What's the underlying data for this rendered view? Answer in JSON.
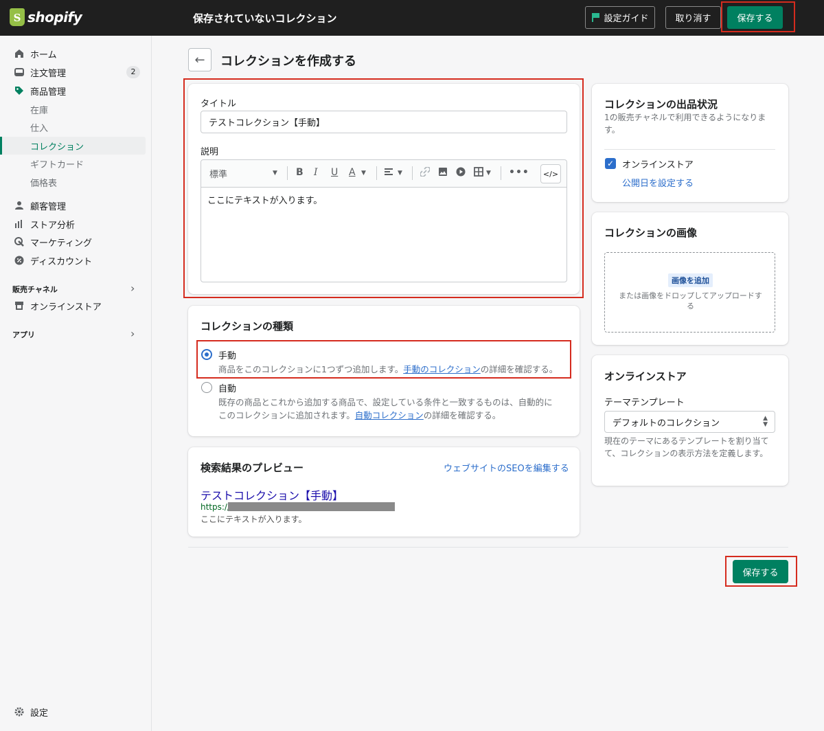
{
  "topbar": {
    "logo_text": "shopify",
    "title": "保存されていないコレクション",
    "guide_label": "設定ガイド",
    "discard_label": "取り消す",
    "save_label": "保存する"
  },
  "sidebar": {
    "items": [
      {
        "label": "ホーム",
        "icon": "home-icon"
      },
      {
        "label": "注文管理",
        "icon": "orders-icon",
        "badge": "2"
      },
      {
        "label": "商品管理",
        "icon": "tag-icon"
      },
      {
        "label": "在庫"
      },
      {
        "label": "仕入"
      },
      {
        "label": "コレクション"
      },
      {
        "label": "ギフトカード"
      },
      {
        "label": "価格表"
      },
      {
        "label": "顧客管理",
        "icon": "customer-icon"
      },
      {
        "label": "ストア分析",
        "icon": "analytics-icon"
      },
      {
        "label": "マーケティング",
        "icon": "marketing-icon"
      },
      {
        "label": "ディスカウント",
        "icon": "discount-icon"
      }
    ],
    "sales_channels_label": "販売チャネル",
    "online_store_label": "オンラインストア",
    "apps_label": "アプリ",
    "settings_label": "設定"
  },
  "page": {
    "back_icon": "arrow-left-icon",
    "title": "コレクションを作成する"
  },
  "details_card": {
    "title_label": "タイトル",
    "title_value": "テストコレクション【手動】",
    "description_label": "説明",
    "format_select": "標準",
    "description_value": "ここにテキストが入ります。"
  },
  "collection_type": {
    "title": "コレクションの種類",
    "manual_label": "手動",
    "manual_help": "商品をこのコレクションに1つずつ追加します。",
    "manual_link": "手動のコレクション",
    "manual_help_suffix": "の詳細を確認する。",
    "auto_label": "自動",
    "auto_help_1": "既存の商品とこれから追加する商品で、設定している条件と一致するものは、自動的に",
    "auto_help_2": "このコレクションに追加されます。",
    "auto_link": "自動コレクション",
    "auto_help_suffix": "の詳細を確認する。",
    "selected": "手動"
  },
  "seo_preview": {
    "title": "検索結果のプレビュー",
    "edit_link": "ウェブサイトのSEOを編集する",
    "preview_title": "テストコレクション【手動】",
    "url_prefix": "https://",
    "description": "ここにテキストが入ります。"
  },
  "availability": {
    "title": "コレクションの出品状況",
    "subtitle": "1の販売チャネルで利用できるようになります。",
    "channel": "オンラインストア",
    "schedule_link": "公開日を設定する"
  },
  "image_card": {
    "title": "コレクションの画像",
    "add_label": "画像を追加",
    "drop_hint": "または画像をドロップしてアップロードする"
  },
  "online_store_card": {
    "title": "オンラインストア",
    "template_label": "テーマテンプレート",
    "template_value": "デフォルトのコレクション",
    "help": "現在のテーマにあるテンプレートを割り当てて、コレクションの表示方法を定義します。"
  },
  "footer": {
    "save_label": "保存する"
  },
  "colors": {
    "primary": "#008060",
    "topbar": "#1f1f1f",
    "highlight": "#d52b1e",
    "link": "#2c6ecb"
  }
}
